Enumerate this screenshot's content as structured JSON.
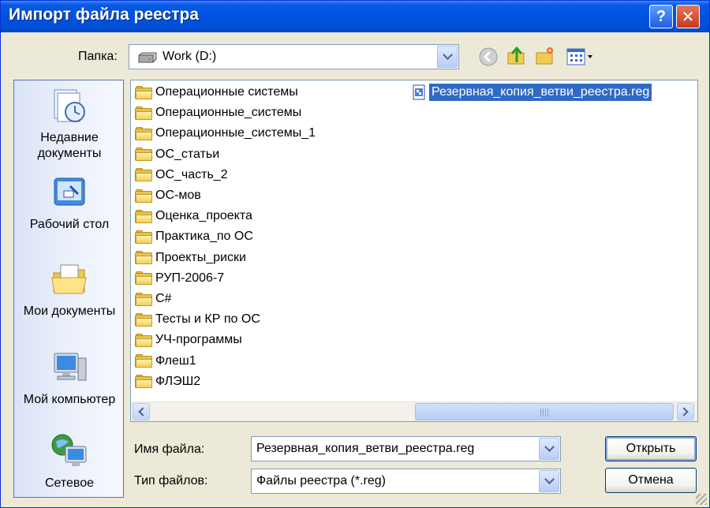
{
  "window": {
    "title": "Импорт файла реестра",
    "help_glyph": "?",
    "close_glyph": "✕"
  },
  "lookin": {
    "label": "Папка:",
    "value": "Work (D:)"
  },
  "places": [
    {
      "label": "Недавние документы",
      "icon": "recent-documents-icon"
    },
    {
      "label": "Рабочий стол",
      "icon": "desktop-icon"
    },
    {
      "label": "Мои документы",
      "icon": "my-documents-icon"
    },
    {
      "label": "Мой компьютер",
      "icon": "my-computer-icon"
    },
    {
      "label": "Сетевое",
      "icon": "network-icon"
    }
  ],
  "folders": [
    "Операционные системы",
    "Операционные_системы",
    "Операционные_системы_1",
    "ОС_статьи",
    "ОС_часть_2",
    "ОС-мов",
    "Оценка_проекта",
    "Практика_по ОС",
    "Проекты_риски",
    "РУП-2006-7",
    "C#",
    "Тесты и КР по ОС",
    "УЧ-программы",
    "Флеш1",
    "ФЛЭШ2"
  ],
  "files": [
    {
      "name": "Резервная_копия_ветви_реестра.reg",
      "selected": true
    }
  ],
  "filename": {
    "label": "Имя файла:",
    "value": "Резервная_копия_ветви_реестра.reg"
  },
  "filetype": {
    "label": "Тип файлов:",
    "value": "Файлы реестра (*.reg)"
  },
  "buttons": {
    "open": "Открыть",
    "cancel": "Отмена"
  },
  "colors": {
    "titlebar": "#0054e3",
    "selection": "#316ac5",
    "window_bg": "#ece9d8"
  }
}
